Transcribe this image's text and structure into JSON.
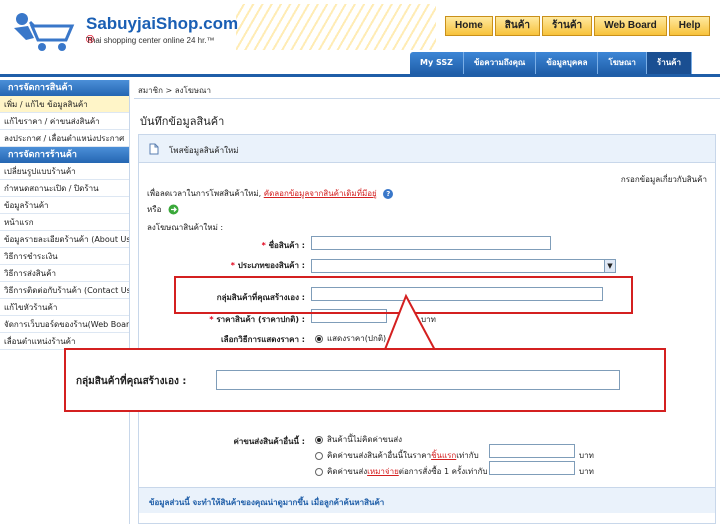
{
  "header": {
    "logo_title": "SabuyjaiShop.com",
    "logo_reg": "®",
    "logo_sub": "Thai shopping center online 24 hr.™",
    "topnav": [
      "Home",
      "สินค้า",
      "ร้านค้า",
      "Web Board",
      "Help"
    ],
    "subnav": [
      "My SSZ",
      "ข้อความถึงคุณ",
      "ข้อมูลบุคคล",
      "โฆษณา",
      "ร้านค้า"
    ]
  },
  "sidebar": {
    "section1": "การจัดการสินค้า",
    "items1": [
      "เพิ่ม / แก้ไข ข้อมูลสินค้า",
      "แก้ไขราคา / ค่าขนส่งสินค้า",
      "ลงประกาศ / เลื่อนตำแหน่งประกาศ"
    ],
    "section2": "การจัดการร้านค้า",
    "items2": [
      "เปลี่ยนรูปแบบร้านค้า",
      "กำหนดสถานะเปิด / ปิดร้าน",
      "ข้อมูลร้านค้า",
      "หน้าแรก",
      "ข้อมูลรายละเอียดร้านค้า (About Us)",
      "วิธีการชำระเงิน",
      "วิธีการส่งสินค้า",
      "วิธีการติดต่อกับร้านค้า (Contact Us)",
      "แก้ไขหัวร้านค้า",
      "จัดการเว็บบอร์ดของร้าน(Web Board)",
      "เลื่อนตำแหน่งร้านค้า"
    ]
  },
  "breadcrumb": "สมาชิก > ลงโฆษณา",
  "page_title": "บันทึกข้อมูลสินค้า",
  "panel": {
    "head": "โพสข้อมูลสินค้าใหม่",
    "top_right": "กรอกข้อมูลเกี่ยวกับสินค้า",
    "copy_prefix": "เพื่อลดเวลาในการโพสสินค้าใหม่,",
    "copy_link": "คัดลอกข้อมูลจากสินค้าเดิมที่มีอยู่",
    "or": "หรือ",
    "post_new": "ลงโฆษณาสินค้าใหม่ :",
    "name_label": "ชื่อสินค้า :",
    "type_label": "ประเภทของสินค้า :",
    "group_label": "กลุ่มสินค้าที่คุณสร้างเอง :",
    "price_label": "ราคาสินค้า (ราคาปกติ) :",
    "baht": "บาท",
    "price_display_label": "เลือกวิธีการแสดงราคา :",
    "price_display_opt": "แสดงราคา(ปกติ)",
    "ship_label": "ค่าขนส่งสินค้าอื่นนี้ :",
    "ship_opt1": "สินค้านี้ไม่คิดค่าขนส่ง",
    "ship_opt2_a": "คิดค่าขนส่งสินค้าอื่นนี้ในราคา",
    "ship_opt2_link": "ชิ้นแรก",
    "ship_opt2_b": "เท่ากับ",
    "ship_opt3_a": "คิดค่าขนส่ง",
    "ship_opt3_link": "เหมาจ่าย",
    "ship_opt3_b": "ต่อการสั่งซื้อ 1 ครั้งเท่ากับ",
    "bottom_note": "ข้อมูลส่วนนี้ จะทำให้สินค้าของคุณน่าดูมากขึ้น เมื่อลูกค้าค้นหาสินค้า"
  },
  "callout": {
    "label": "กลุ่มสินค้าที่คุณสร้างเอง :"
  },
  "colors": {
    "accent": "#1f5ea8",
    "highlight": "#d42020",
    "nav": "#f7c23b"
  }
}
